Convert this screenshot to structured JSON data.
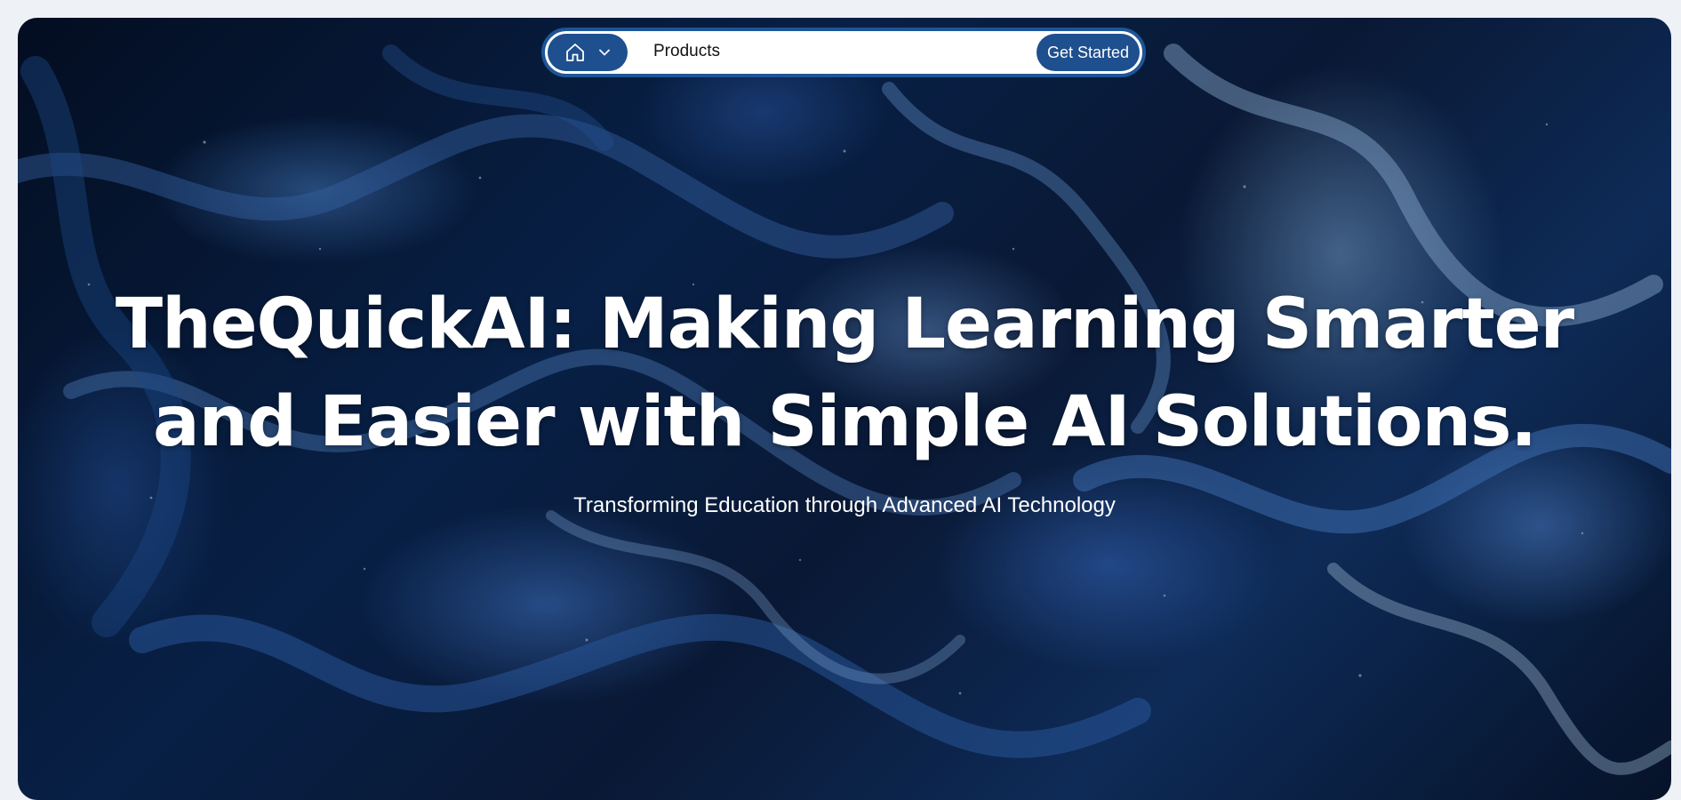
{
  "nav": {
    "home_icon": "home-icon",
    "dropdown_icon": "chevron-down-icon",
    "products_label": "Products",
    "cta_label": "Get Started"
  },
  "hero": {
    "headline_line1": "TheQuickAI: Making Learning Smarter",
    "headline_line2": "and Easier with Simple AI Solutions.",
    "subheadline": "Transforming Education through Advanced AI Technology"
  },
  "colors": {
    "page_background": "#eef1f6",
    "nav_accent": "#1e4f8e",
    "nav_background": "#ffffff",
    "hero_text": "#ffffff"
  }
}
